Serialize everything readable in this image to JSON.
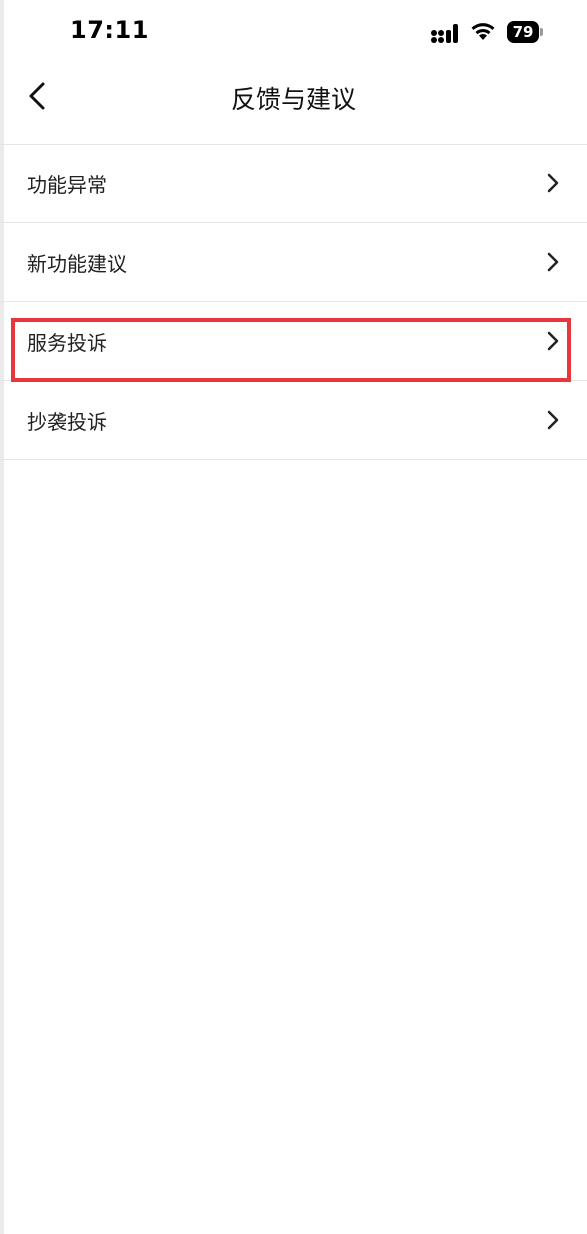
{
  "status_bar": {
    "time": "17:11",
    "battery": "79",
    "icons": [
      "signal-icon",
      "wifi-icon",
      "battery-icon"
    ]
  },
  "nav": {
    "title": "反馈与建议",
    "back_icon": "chevron-left-icon"
  },
  "menu": {
    "items": [
      {
        "label": "功能异常"
      },
      {
        "label": "新功能建议"
      },
      {
        "label": "服务投诉",
        "highlighted": true
      },
      {
        "label": "抄袭投诉"
      }
    ],
    "chevron_icon": "chevron-right-icon"
  },
  "colors": {
    "highlight": "#e8363d",
    "divider": "#e6e6e6",
    "text": "#222222"
  }
}
